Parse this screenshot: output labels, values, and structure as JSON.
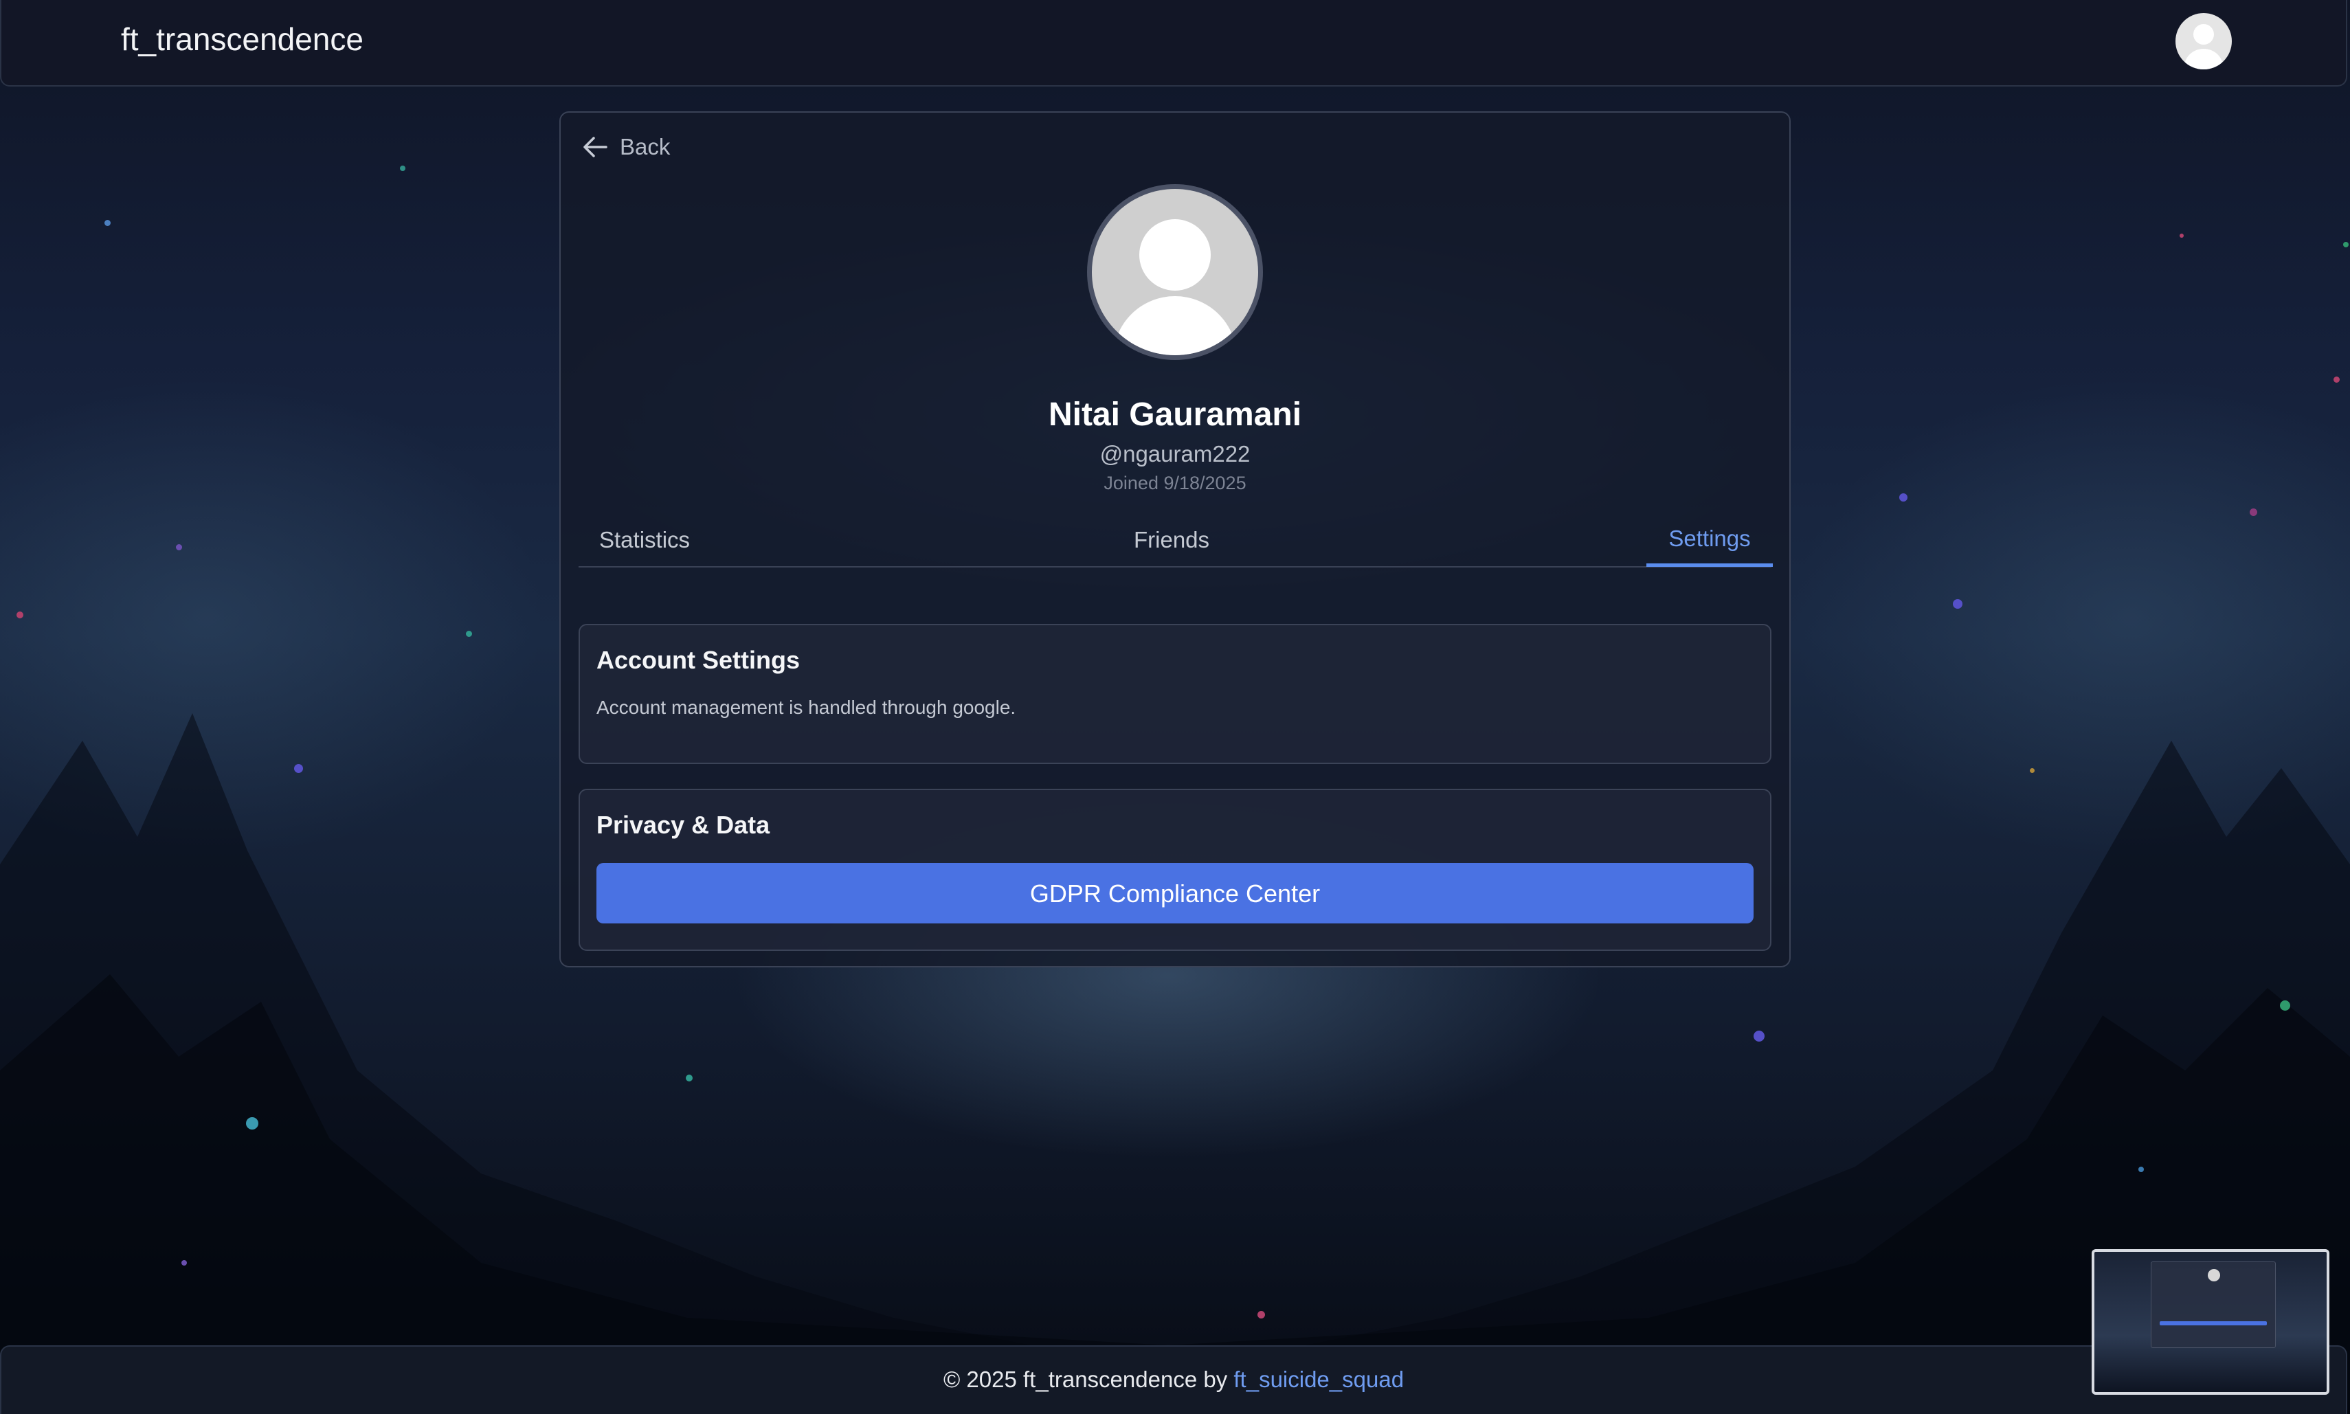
{
  "app": {
    "brand": "ft_transcendence"
  },
  "header": {
    "avatar_icon": "user-avatar-icon"
  },
  "profile": {
    "back_label": "Back",
    "name": "Nitai Gauramani",
    "handle": "@ngauram222",
    "joined": "Joined 9/18/2025"
  },
  "tabs": [
    {
      "label": "Statistics",
      "active": false
    },
    {
      "label": "Friends",
      "active": false
    },
    {
      "label": "Settings",
      "active": true
    }
  ],
  "settings": {
    "account_title": "Account Settings",
    "account_text": "Account management is handled through google.",
    "privacy_title": "Privacy & Data",
    "gdpr_button": "GDPR Compliance Center"
  },
  "footer": {
    "prefix": "© 2025 ft_transcendence by ",
    "link": "ft_suicide_squad"
  },
  "colors": {
    "accent": "#5b8dee",
    "button": "#4a72e3",
    "link": "#6f9cf0"
  }
}
